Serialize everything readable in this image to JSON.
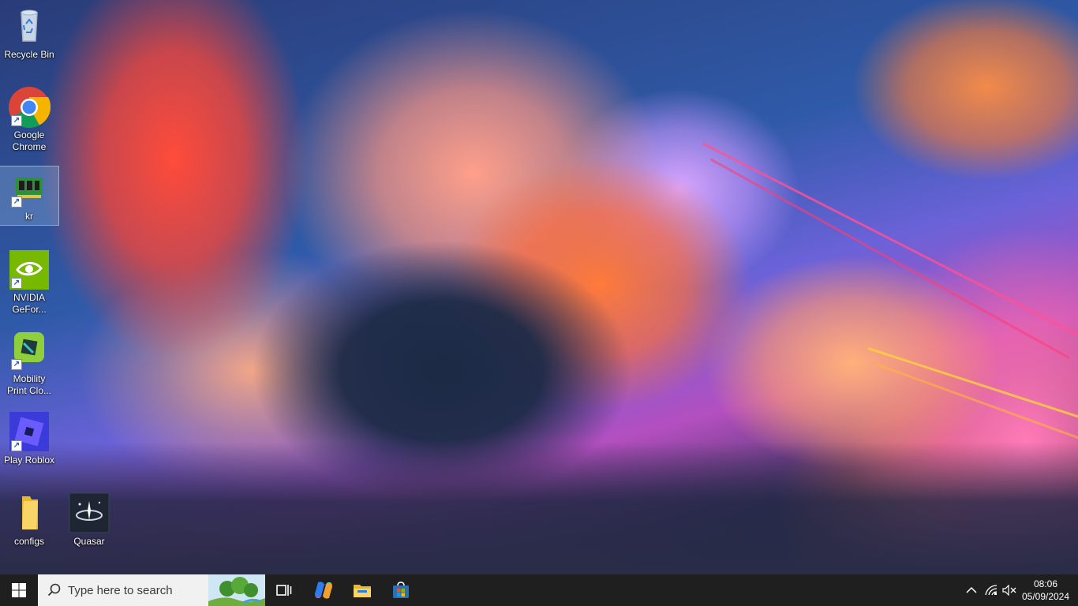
{
  "desktop": {
    "icons": [
      {
        "label": "Recycle Bin",
        "icon": "recycle-bin-icon"
      },
      {
        "label": "Google Chrome",
        "icon": "chrome-icon"
      },
      {
        "label": "kr",
        "icon": "kr-app-icon"
      },
      {
        "label": "NVIDIA GeFor...",
        "icon": "nvidia-icon"
      },
      {
        "label": "Mobility Print Clo...",
        "icon": "mobility-print-icon"
      },
      {
        "label": "Play Roblox",
        "icon": "roblox-icon"
      },
      {
        "label": "configs",
        "icon": "folder-icon"
      },
      {
        "label": "Quasar",
        "icon": "quasar-icon"
      }
    ]
  },
  "taskbar": {
    "search_placeholder": "Type here to search",
    "pinned": [
      "task-view-icon",
      "copilot-icon",
      "file-explorer-icon",
      "microsoft-store-icon"
    ],
    "tray": [
      "chevron-up-icon",
      "network-icon",
      "volume-muted-icon"
    ],
    "clock": {
      "time": "08:06",
      "date": "05/09/2024"
    }
  },
  "colors": {
    "taskbar": "#1f1f1f",
    "search_box": "#f1f1f1",
    "selection": "#8cb4dc"
  }
}
